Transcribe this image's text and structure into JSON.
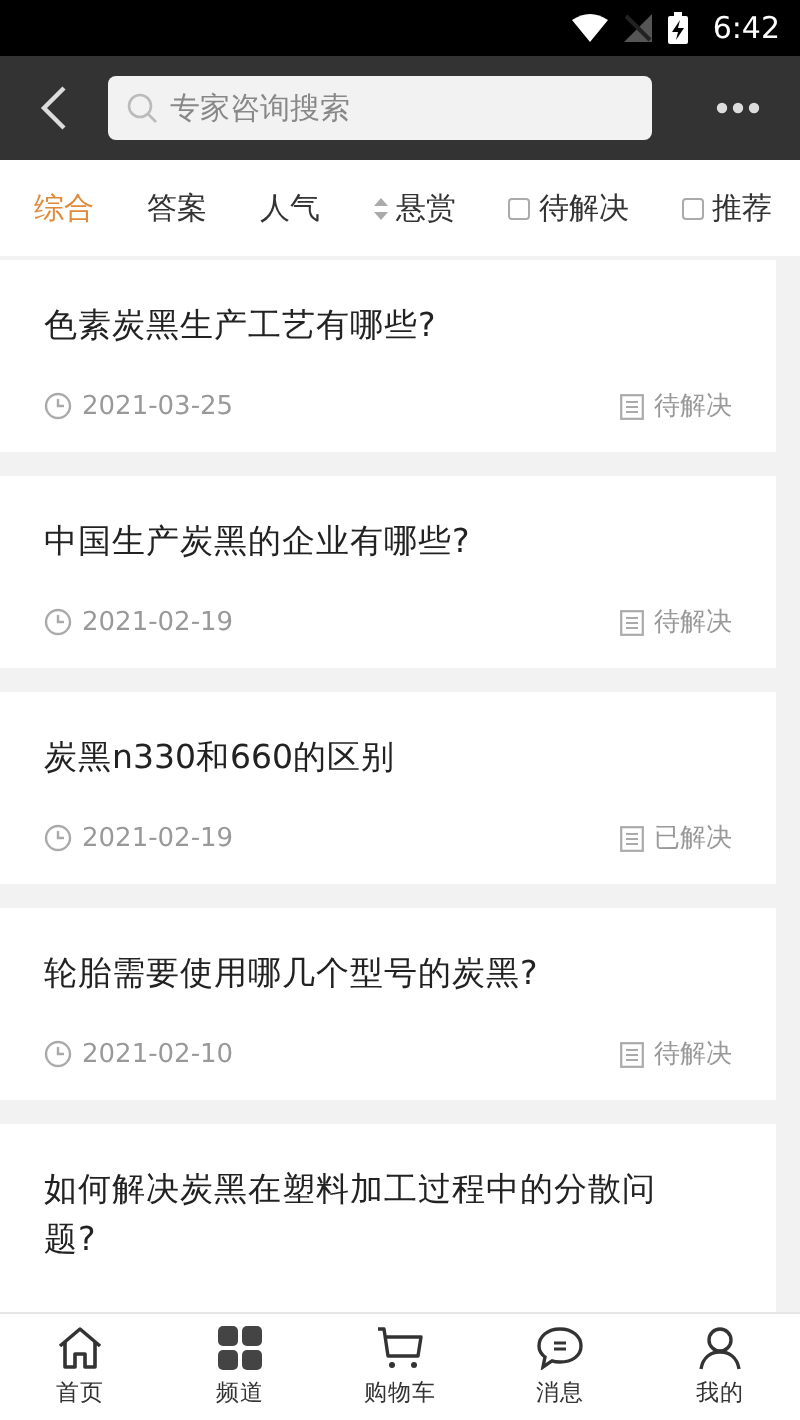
{
  "status_bar": {
    "time": "6:42"
  },
  "header": {
    "search": {
      "placeholder": "专家咨询搜索"
    }
  },
  "filters": [
    {
      "kind": "tab",
      "label": "综合",
      "selected": true
    },
    {
      "kind": "tab",
      "label": "答案",
      "selected": false
    },
    {
      "kind": "tab",
      "label": "人气",
      "selected": false
    },
    {
      "kind": "sort",
      "label": "悬赏",
      "selected": false
    },
    {
      "kind": "check",
      "label": "待解决",
      "checked": false
    },
    {
      "kind": "check",
      "label": "推荐",
      "checked": false
    }
  ],
  "questions": [
    {
      "title": "色素炭黑生产工艺有哪些?",
      "date": "2021-03-25",
      "status": "待解决"
    },
    {
      "title": "中国生产炭黑的企业有哪些?",
      "date": "2021-02-19",
      "status": "待解决"
    },
    {
      "title": "炭黑n330和660的区别",
      "date": "2021-02-19",
      "status": "已解决"
    },
    {
      "title": "轮胎需要使用哪几个型号的炭黑?",
      "date": "2021-02-10",
      "status": "待解决"
    },
    {
      "title": "如何解决炭黑在塑料加工过程中的分散问题?"
    }
  ],
  "tab_bar": [
    {
      "kind": "home",
      "label": "首页"
    },
    {
      "kind": "grid",
      "label": "频道"
    },
    {
      "kind": "cart",
      "label": "购物车"
    },
    {
      "kind": "chat",
      "label": "消息"
    },
    {
      "kind": "user",
      "label": "我的"
    }
  ]
}
